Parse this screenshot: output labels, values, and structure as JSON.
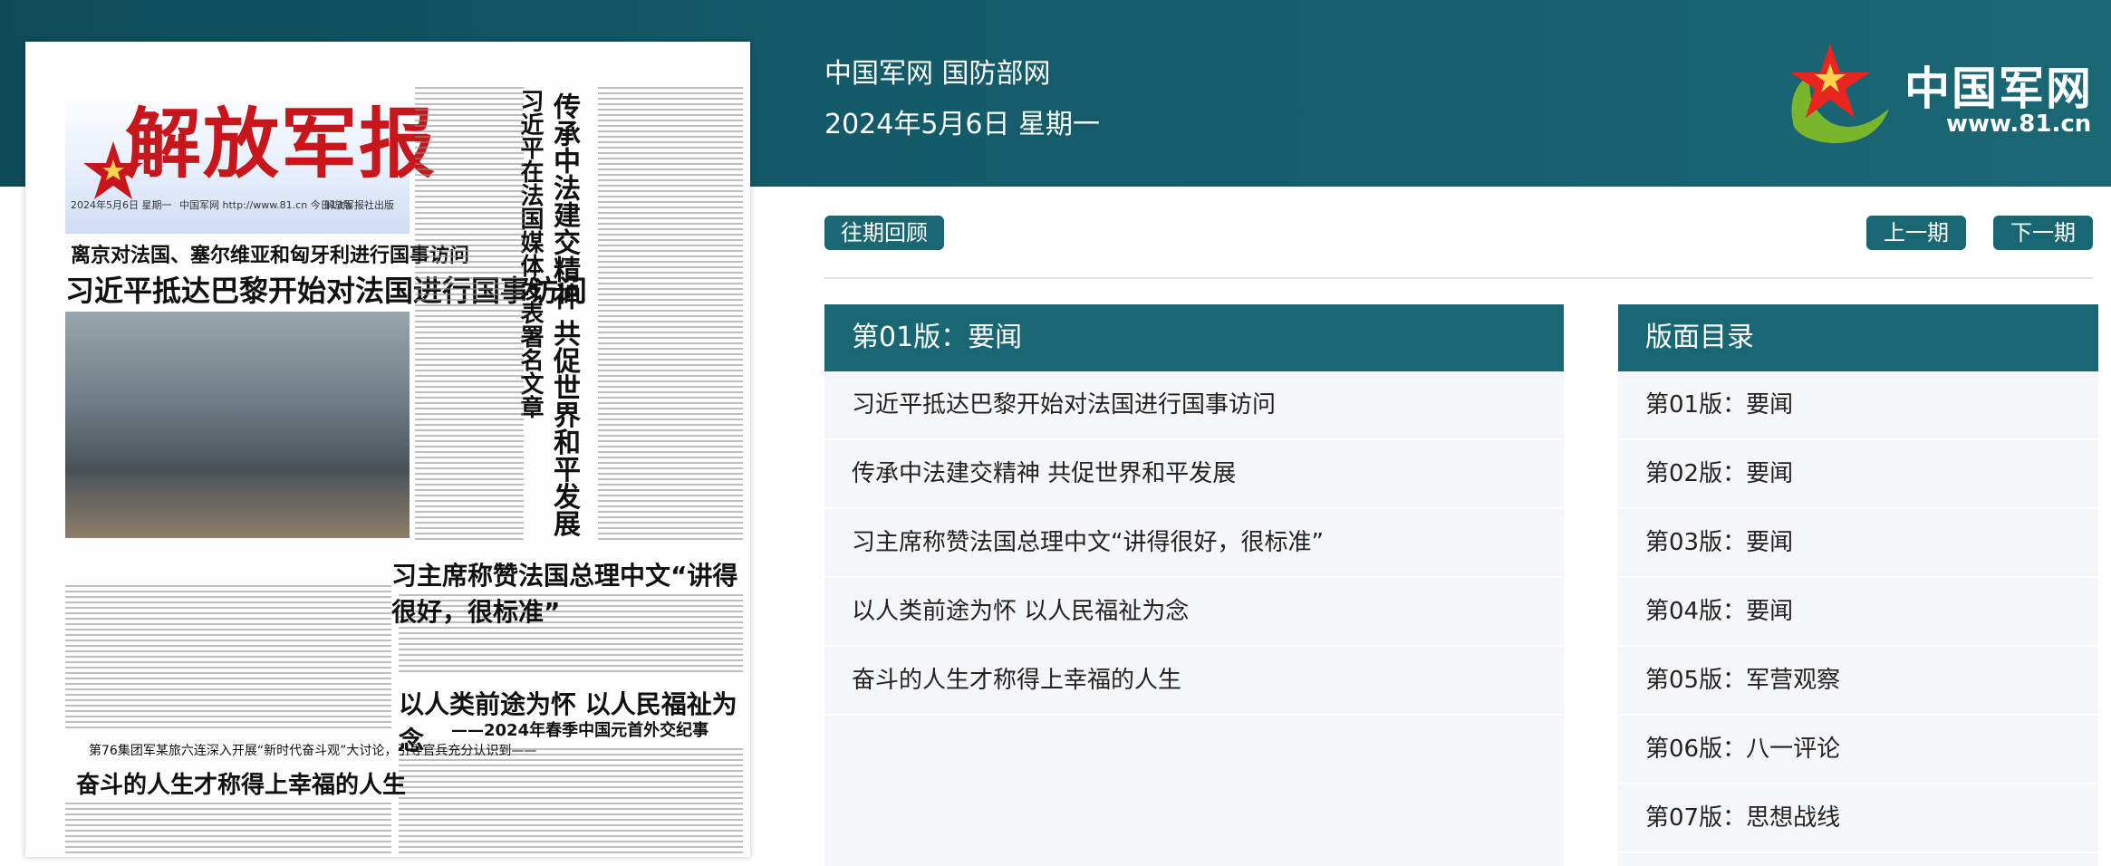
{
  "header": {
    "site_name": "中国军网 国防部网",
    "date": "2024年5月6日  星期一",
    "logo_text": "中国军网",
    "logo_url": "www.81.cn"
  },
  "newspaper": {
    "masthead": "解放军报",
    "date_line": "2024年5月6日  星期一",
    "info_line": "中国军网 http://www.81.cn  今日12版",
    "code_line": "解放军报社出版",
    "headline_sub": "离京对法国、塞尔维亚和匈牙利进行国事访问",
    "headline_main": "习近平抵达巴黎开始对法国进行国事访问",
    "vertical_title": "传承中法建交精神  共促世界和平发展",
    "vertical_author": "习近平在法国媒体发表署名文章",
    "headline_praise": "习主席称赞法国总理中文“讲得很好，很标准”",
    "headline_people": "以人类前途为怀  以人民福祉为念",
    "headline_people_sub": "——2024年春季中国元首外交纪事",
    "headline_small": "第76集团军某旅六连深入开展“新时代奋斗观”大讨论，引导官兵充分认识到——",
    "headline_struggle": "奋斗的人生才称得上幸福的人生"
  },
  "nav": {
    "archive": "往期回顾",
    "prev": "上一期",
    "next": "下一期"
  },
  "articles": {
    "title": "第01版：要闻",
    "items": [
      "习近平抵达巴黎开始对法国进行国事访问",
      "传承中法建交精神 共促世界和平发展",
      "习主席称赞法国总理中文“讲得很好，很标准”",
      "以人类前途为怀 以人民福祉为念",
      "奋斗的人生才称得上幸福的人生"
    ]
  },
  "toc": {
    "title": "版面目录",
    "items": [
      "第01版：要闻",
      "第02版：要闻",
      "第03版：要闻",
      "第04版：要闻",
      "第05版：军营观察",
      "第06版：八一评论",
      "第07版：思想战线"
    ]
  },
  "colors": {
    "header_bg": "#145a68",
    "accent": "#1a6774",
    "panel_bg": "#f4f6f8",
    "masthead_red": "#c8161d"
  }
}
